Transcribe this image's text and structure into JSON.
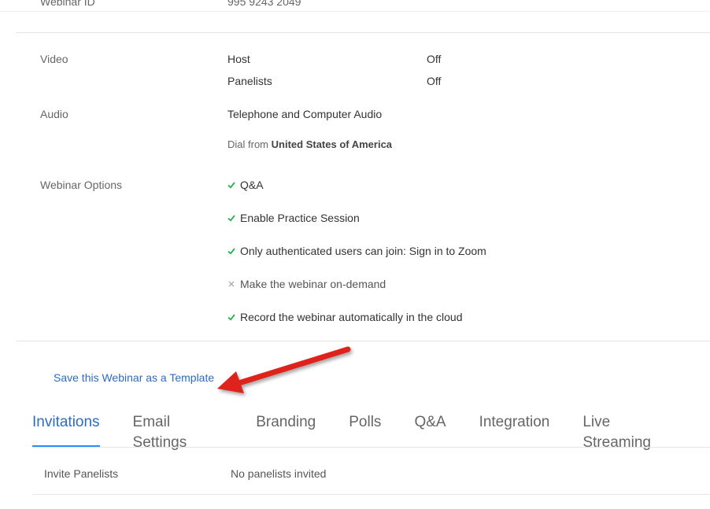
{
  "cut_row": {
    "label": "Webinar ID",
    "value": "995 9243 2049"
  },
  "video": {
    "label": "Video",
    "rows": [
      {
        "name": "Host",
        "value": "Off"
      },
      {
        "name": "Panelists",
        "value": "Off"
      }
    ]
  },
  "audio": {
    "label": "Audio",
    "value": "Telephone and Computer Audio",
    "dial_prefix": "Dial from",
    "dial_country": "United States of America"
  },
  "webinar_options": {
    "label": "Webinar Options",
    "items": [
      {
        "text": "Q&A",
        "enabled": true
      },
      {
        "text": "Enable Practice Session",
        "enabled": true
      },
      {
        "text": "Only authenticated users can join: Sign in to Zoom",
        "enabled": true
      },
      {
        "text": "Make the webinar on-demand",
        "enabled": false
      },
      {
        "text": "Record the webinar automatically in the cloud",
        "enabled": true
      }
    ]
  },
  "template_link": "Save this Webinar as a Template",
  "tabs": [
    {
      "label": "Invitations",
      "active": true
    },
    {
      "label": "Email Settings",
      "active": false
    },
    {
      "label": "Branding",
      "active": false
    },
    {
      "label": "Polls",
      "active": false
    },
    {
      "label": "Q&A",
      "active": false
    },
    {
      "label": "Integration",
      "active": false
    },
    {
      "label": "Live Streaming",
      "active": false
    }
  ],
  "invitations": {
    "label": "Invite Panelists",
    "value": "No panelists invited"
  },
  "icons": {
    "enabled": "checkmark-icon",
    "disabled": "cross-icon",
    "annotation": "red-arrow"
  },
  "colors": {
    "accent": "#2d8cff",
    "link": "#2d6cc0",
    "check": "#23b14d",
    "cross": "#aaaaaa",
    "arrow": "#e0201a"
  }
}
